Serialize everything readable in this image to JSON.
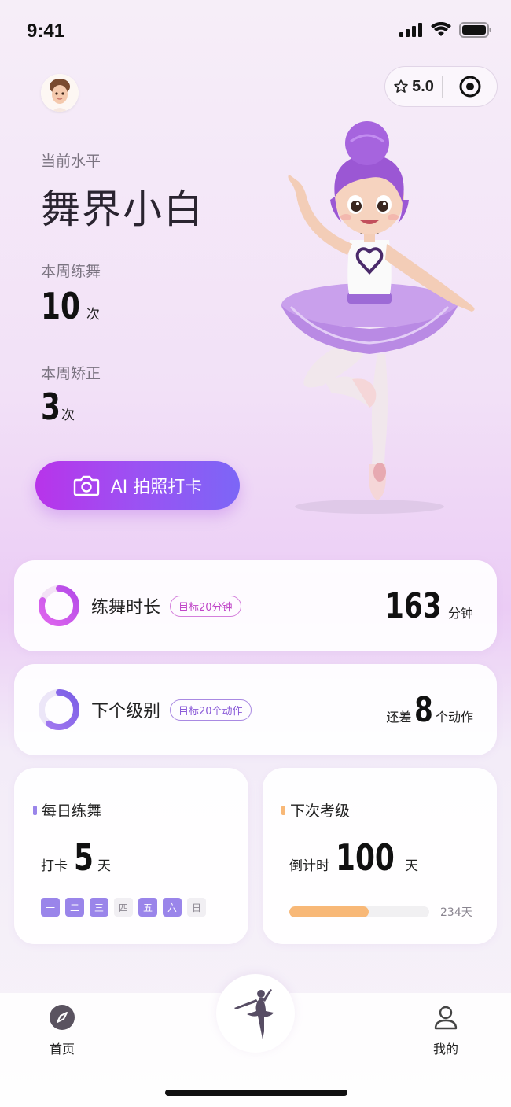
{
  "status": {
    "time": "9:41"
  },
  "header": {
    "rating": "5.0"
  },
  "profile": {
    "level_label": "当前水平",
    "level_value": "舞界小白",
    "weekly_practice_label": "本周练舞",
    "weekly_practice_value": "10",
    "weekly_practice_unit": "次",
    "weekly_correct_label": "本周矫正",
    "weekly_correct_value": "3",
    "weekly_correct_unit": "次"
  },
  "cta": {
    "label": "AI 拍照打卡"
  },
  "duration_card": {
    "title": "练舞时长",
    "goal": "目标20分钟",
    "value": "163",
    "unit": "分钟",
    "ring_progress": 0.8
  },
  "next_level_card": {
    "title": "下个级别",
    "goal": "目标20个动作",
    "prefix": "还差",
    "value": "8",
    "unit": "个动作",
    "ring_progress": 0.6
  },
  "daily_card": {
    "title": "每日练舞",
    "prefix": "打卡",
    "value": "5",
    "unit": "天",
    "days": [
      {
        "label": "一",
        "checked": true
      },
      {
        "label": "二",
        "checked": true
      },
      {
        "label": "三",
        "checked": true
      },
      {
        "label": "四",
        "checked": false
      },
      {
        "label": "五",
        "checked": true
      },
      {
        "label": "六",
        "checked": true
      },
      {
        "label": "日",
        "checked": false
      }
    ],
    "accent": "#9a85ea"
  },
  "exam_card": {
    "title": "下次考级",
    "prefix": "倒计时",
    "value": "100",
    "unit": "天",
    "total_label": "234天",
    "progress": 0.57,
    "accent": "#f8b877"
  },
  "tabbar": {
    "home_label": "首页",
    "mine_label": "我的"
  }
}
